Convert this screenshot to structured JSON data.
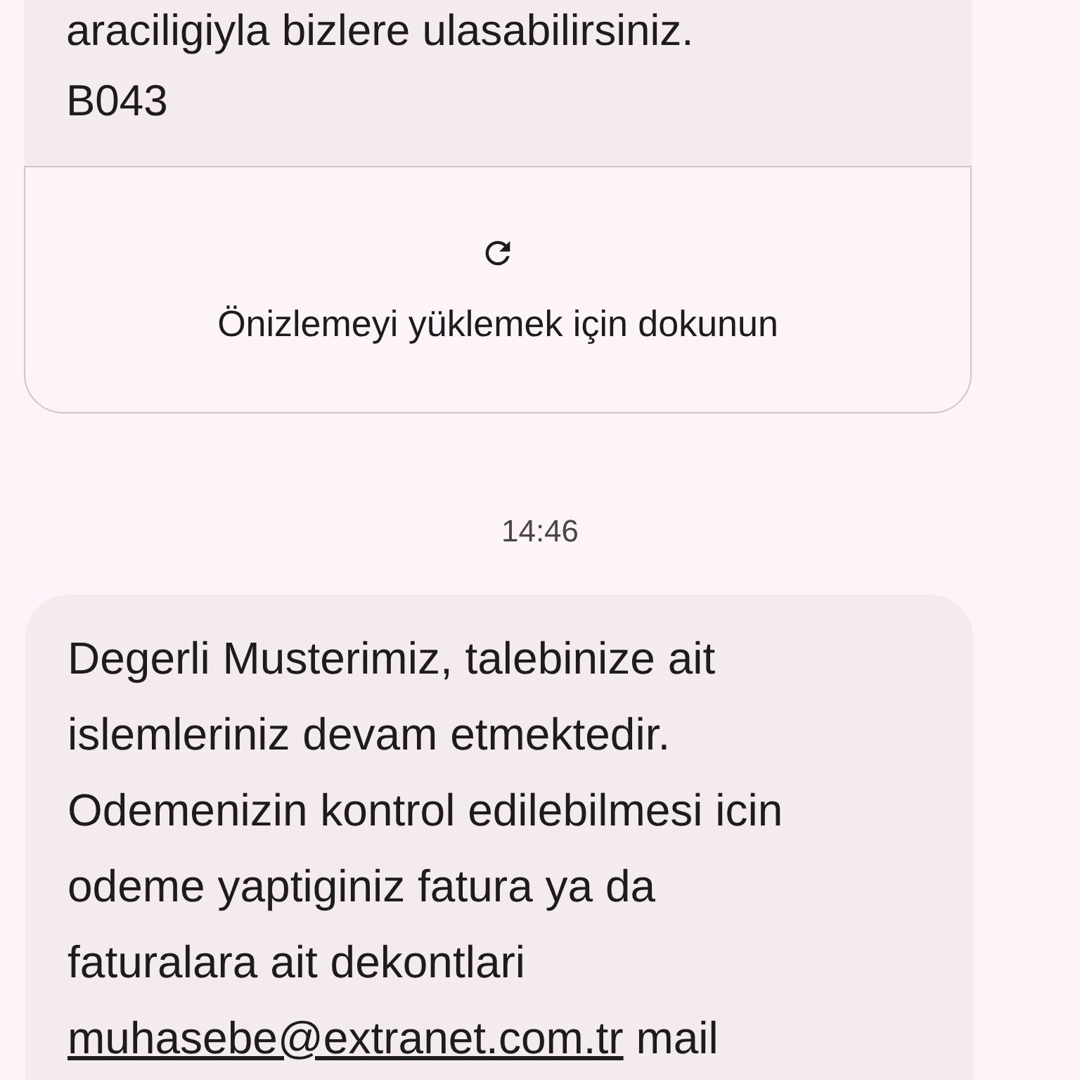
{
  "messages": [
    {
      "kind": "received",
      "lines": [
        "araciligiyla bizlere ulasabilirsiniz.",
        "B043"
      ],
      "preview": {
        "label": "Önizlemeyi yüklemek için dokunun"
      }
    },
    {
      "kind": "timestamp",
      "text": "14:46"
    },
    {
      "kind": "received",
      "paragraph": {
        "before": "Degerli Musterimiz, talebinize ait islemleriniz devam etmektedir. Odemenizin kontrol edilebilmesi icin odeme yaptiginiz fatura ya da faturalara ait dekontlari",
        "link": "muhasebe@extranet.com.tr",
        "after": "mail"
      }
    }
  ]
}
